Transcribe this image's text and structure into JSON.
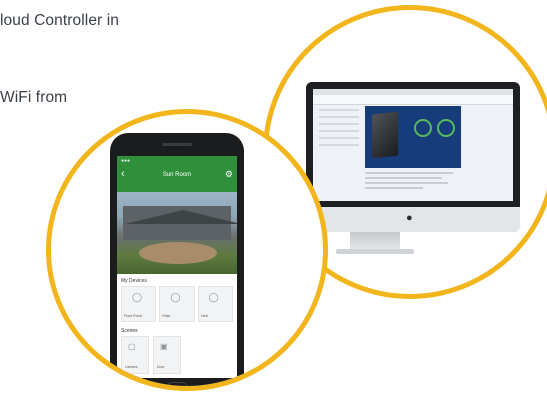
{
  "texts": {
    "line1": "loud Controller in",
    "line2": "WiFi from"
  },
  "monitor": {
    "logo_icon": "apple-logo-icon"
  },
  "phone": {
    "status": "●●●",
    "header_title": "Sun Room",
    "back_icon": "chevron-left-icon",
    "settings_icon": "gear-icon",
    "section_devices": "My Devices",
    "devices": [
      {
        "icon": "bulb-icon",
        "label": "Front Porch"
      },
      {
        "icon": "bulb-icon",
        "label": "Patio"
      },
      {
        "icon": "bulb-icon",
        "label": "Yard"
      }
    ],
    "section_groups": "Scenes",
    "cards": [
      {
        "icon": "camera-icon",
        "label": "Camera"
      },
      {
        "icon": "lock-icon",
        "label": "Door"
      }
    ]
  },
  "colors": {
    "ring": "#f2b51c",
    "app_green": "#2f8f3a",
    "dashboard_blue": "#163d7a"
  }
}
